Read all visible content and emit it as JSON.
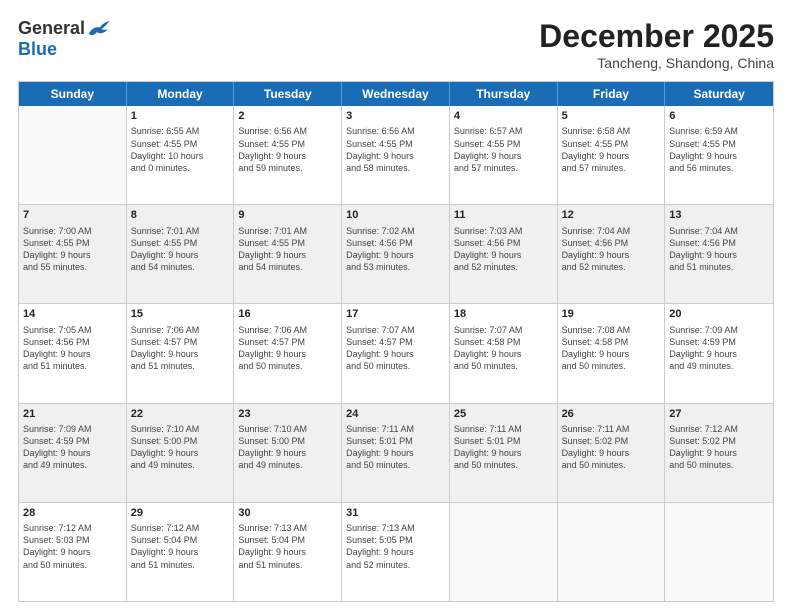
{
  "header": {
    "logo_general": "General",
    "logo_blue": "Blue",
    "month_title": "December 2025",
    "subtitle": "Tancheng, Shandong, China"
  },
  "weekdays": [
    "Sunday",
    "Monday",
    "Tuesday",
    "Wednesday",
    "Thursday",
    "Friday",
    "Saturday"
  ],
  "rows": [
    {
      "shaded": false,
      "cells": [
        {
          "empty": true,
          "day": "",
          "text": ""
        },
        {
          "empty": false,
          "day": "1",
          "text": "Sunrise: 6:55 AM\nSunset: 4:55 PM\nDaylight: 10 hours\nand 0 minutes."
        },
        {
          "empty": false,
          "day": "2",
          "text": "Sunrise: 6:56 AM\nSunset: 4:55 PM\nDaylight: 9 hours\nand 59 minutes."
        },
        {
          "empty": false,
          "day": "3",
          "text": "Sunrise: 6:56 AM\nSunset: 4:55 PM\nDaylight: 9 hours\nand 58 minutes."
        },
        {
          "empty": false,
          "day": "4",
          "text": "Sunrise: 6:57 AM\nSunset: 4:55 PM\nDaylight: 9 hours\nand 57 minutes."
        },
        {
          "empty": false,
          "day": "5",
          "text": "Sunrise: 6:58 AM\nSunset: 4:55 PM\nDaylight: 9 hours\nand 57 minutes."
        },
        {
          "empty": false,
          "day": "6",
          "text": "Sunrise: 6:59 AM\nSunset: 4:55 PM\nDaylight: 9 hours\nand 56 minutes."
        }
      ]
    },
    {
      "shaded": true,
      "cells": [
        {
          "empty": false,
          "day": "7",
          "text": "Sunrise: 7:00 AM\nSunset: 4:55 PM\nDaylight: 9 hours\nand 55 minutes."
        },
        {
          "empty": false,
          "day": "8",
          "text": "Sunrise: 7:01 AM\nSunset: 4:55 PM\nDaylight: 9 hours\nand 54 minutes."
        },
        {
          "empty": false,
          "day": "9",
          "text": "Sunrise: 7:01 AM\nSunset: 4:55 PM\nDaylight: 9 hours\nand 54 minutes."
        },
        {
          "empty": false,
          "day": "10",
          "text": "Sunrise: 7:02 AM\nSunset: 4:56 PM\nDaylight: 9 hours\nand 53 minutes."
        },
        {
          "empty": false,
          "day": "11",
          "text": "Sunrise: 7:03 AM\nSunset: 4:56 PM\nDaylight: 9 hours\nand 52 minutes."
        },
        {
          "empty": false,
          "day": "12",
          "text": "Sunrise: 7:04 AM\nSunset: 4:56 PM\nDaylight: 9 hours\nand 52 minutes."
        },
        {
          "empty": false,
          "day": "13",
          "text": "Sunrise: 7:04 AM\nSunset: 4:56 PM\nDaylight: 9 hours\nand 51 minutes."
        }
      ]
    },
    {
      "shaded": false,
      "cells": [
        {
          "empty": false,
          "day": "14",
          "text": "Sunrise: 7:05 AM\nSunset: 4:56 PM\nDaylight: 9 hours\nand 51 minutes."
        },
        {
          "empty": false,
          "day": "15",
          "text": "Sunrise: 7:06 AM\nSunset: 4:57 PM\nDaylight: 9 hours\nand 51 minutes."
        },
        {
          "empty": false,
          "day": "16",
          "text": "Sunrise: 7:06 AM\nSunset: 4:57 PM\nDaylight: 9 hours\nand 50 minutes."
        },
        {
          "empty": false,
          "day": "17",
          "text": "Sunrise: 7:07 AM\nSunset: 4:57 PM\nDaylight: 9 hours\nand 50 minutes."
        },
        {
          "empty": false,
          "day": "18",
          "text": "Sunrise: 7:07 AM\nSunset: 4:58 PM\nDaylight: 9 hours\nand 50 minutes."
        },
        {
          "empty": false,
          "day": "19",
          "text": "Sunrise: 7:08 AM\nSunset: 4:58 PM\nDaylight: 9 hours\nand 50 minutes."
        },
        {
          "empty": false,
          "day": "20",
          "text": "Sunrise: 7:09 AM\nSunset: 4:59 PM\nDaylight: 9 hours\nand 49 minutes."
        }
      ]
    },
    {
      "shaded": true,
      "cells": [
        {
          "empty": false,
          "day": "21",
          "text": "Sunrise: 7:09 AM\nSunset: 4:59 PM\nDaylight: 9 hours\nand 49 minutes."
        },
        {
          "empty": false,
          "day": "22",
          "text": "Sunrise: 7:10 AM\nSunset: 5:00 PM\nDaylight: 9 hours\nand 49 minutes."
        },
        {
          "empty": false,
          "day": "23",
          "text": "Sunrise: 7:10 AM\nSunset: 5:00 PM\nDaylight: 9 hours\nand 49 minutes."
        },
        {
          "empty": false,
          "day": "24",
          "text": "Sunrise: 7:11 AM\nSunset: 5:01 PM\nDaylight: 9 hours\nand 50 minutes."
        },
        {
          "empty": false,
          "day": "25",
          "text": "Sunrise: 7:11 AM\nSunset: 5:01 PM\nDaylight: 9 hours\nand 50 minutes."
        },
        {
          "empty": false,
          "day": "26",
          "text": "Sunrise: 7:11 AM\nSunset: 5:02 PM\nDaylight: 9 hours\nand 50 minutes."
        },
        {
          "empty": false,
          "day": "27",
          "text": "Sunrise: 7:12 AM\nSunset: 5:02 PM\nDaylight: 9 hours\nand 50 minutes."
        }
      ]
    },
    {
      "shaded": false,
      "cells": [
        {
          "empty": false,
          "day": "28",
          "text": "Sunrise: 7:12 AM\nSunset: 5:03 PM\nDaylight: 9 hours\nand 50 minutes."
        },
        {
          "empty": false,
          "day": "29",
          "text": "Sunrise: 7:12 AM\nSunset: 5:04 PM\nDaylight: 9 hours\nand 51 minutes."
        },
        {
          "empty": false,
          "day": "30",
          "text": "Sunrise: 7:13 AM\nSunset: 5:04 PM\nDaylight: 9 hours\nand 51 minutes."
        },
        {
          "empty": false,
          "day": "31",
          "text": "Sunrise: 7:13 AM\nSunset: 5:05 PM\nDaylight: 9 hours\nand 52 minutes."
        },
        {
          "empty": true,
          "day": "",
          "text": ""
        },
        {
          "empty": true,
          "day": "",
          "text": ""
        },
        {
          "empty": true,
          "day": "",
          "text": ""
        }
      ]
    }
  ]
}
